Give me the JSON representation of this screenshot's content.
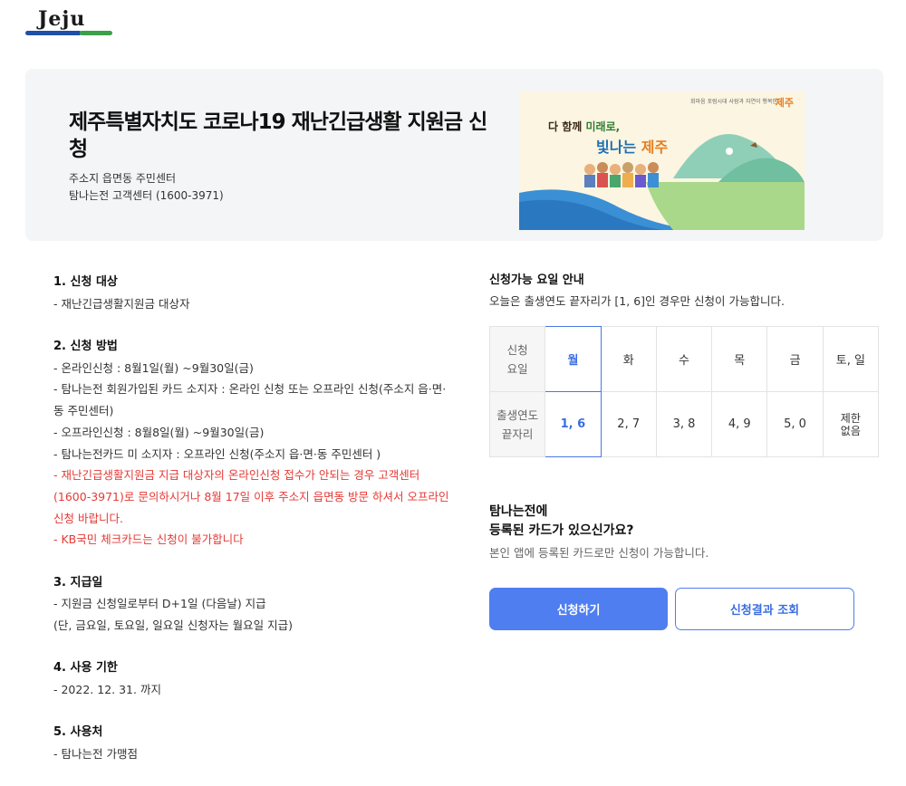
{
  "logo": {
    "text": "Jeju"
  },
  "hero": {
    "title": "제주특별자치도 코로나19 재난긴급생활 지원금 신청",
    "sub1": "주소지 읍면동 주민센터",
    "sub2": "탐나는전 고객센터 (1600-3971)",
    "banner": {
      "slogan_part1": "다 함께 ",
      "slogan_highlight": "미래로,",
      "slogan2_part1": "빛나는 ",
      "slogan2_jeju": "제주",
      "top_text": "회마음 포럼시대 사람과 자연이 행복한",
      "brand": "제주"
    }
  },
  "left": {
    "s1_title": "1. 신청 대상",
    "s1_l1": "- 재난긴급생활지원금 대상자",
    "s2_title": "2. 신청 방법",
    "s2_l1": "- 온라인신청 : 8월1일(월) ~9월30일(금)",
    "s2_l2": "- 탐나는전 회원가입된 카드 소지자 : 온라인 신청 또는 오프라인 신청(주소지 읍·면·",
    "s2_l3": "동 주민센터)",
    "s2_l4": "- 오프라인신청 : 8월8일(월) ~9월30일(금)",
    "s2_l5": "- 탐나는전카드 미 소지자 : 오프라인 신청(주소지 읍·면·동 주민센터 )",
    "s2_red1": "- 재난긴급생활지원금 지급 대상자의 온라인신청 접수가 안되는 경우 고객센터",
    "s2_red2": "(1600-3971)로 문의하시거나 8월 17일 이후 주소지 읍면동 방문 하셔서 오프라인",
    "s2_red3": "신청 바랍니다.",
    "s2_red4": "- KB국민 체크카드는 신청이 불가합니다",
    "s3_title": "3. 지급일",
    "s3_l1": "- 지원금 신청일로부터 D+1일 (다음날) 지급",
    "s3_l2": "(단, 금요일, 토요일, 일요일 신청자는 월요일 지급)",
    "s4_title": "4. 사용 기한",
    "s4_l1": "- 2022. 12. 31. 까지",
    "s5_title": "5. 사용처",
    "s5_l1": "- 탐나는전 가맹점"
  },
  "schedule": {
    "title": "신청가능 요일 안내",
    "desc": "오늘은 출생연도 끝자리가 [1, 6]인 경우만 신청이 가능합니다.",
    "row1_head_a": "신청",
    "row1_head_b": "요일",
    "row2_head_a": "출생연도",
    "row2_head_b": "끝자리",
    "days": [
      "월",
      "화",
      "수",
      "목",
      "금",
      "토, 일"
    ],
    "digits": [
      "1, 6",
      "2, 7",
      "3, 8",
      "4, 9",
      "5, 0"
    ],
    "limit_a": "제한",
    "limit_b": "없음"
  },
  "card": {
    "q1": "탐나는전에",
    "q2": "등록된 카드가 있으신가요?",
    "desc": "본인 앱에 등록된 카드로만 신청이 가능합니다."
  },
  "buttons": {
    "apply": "신청하기",
    "result": "신청결과 조회"
  },
  "colors": {
    "primary": "#4f7ef0",
    "warning": "#e53935",
    "hero_bg": "#f4f5f7"
  }
}
